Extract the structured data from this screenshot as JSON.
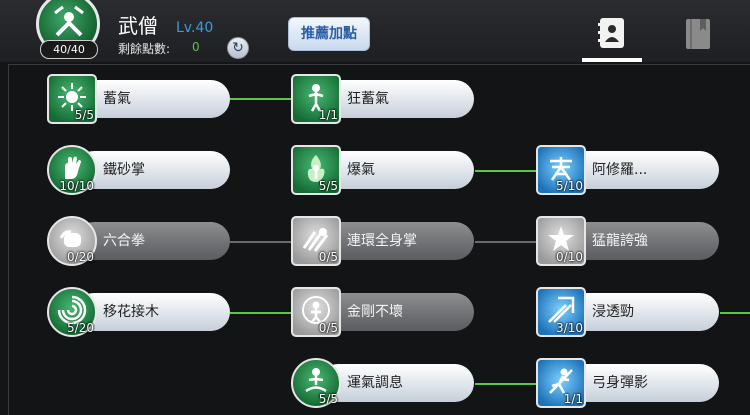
{
  "header": {
    "class_name": "武僧",
    "level": "Lv.40",
    "points_label": "剩餘點數:",
    "points_value": "0",
    "hp": "40/40",
    "recommend_label": "推薦加點",
    "refresh_icon": "refresh-icon",
    "tabs": [
      {
        "icon": "contact-book-icon",
        "active": true
      },
      {
        "icon": "bookmark-book-icon",
        "active": false
      }
    ]
  },
  "colors": {
    "connector_active": "#5bc64a",
    "connector_locked": "#6a6b6e",
    "level_blue": "#3d9ae0",
    "points_green": "#58c34a"
  },
  "skills": [
    {
      "name": "蓄氣",
      "level": "5/5",
      "shape": "square",
      "theme": "green",
      "locked": false,
      "icon": "sun-burst-icon"
    },
    {
      "name": "狂蓄氣",
      "level": "1/1",
      "shape": "square",
      "theme": "green",
      "locked": false,
      "icon": "power-up-figure-icon"
    },
    {
      "name": "鐵砂掌",
      "level": "10/10",
      "shape": "circle",
      "theme": "green",
      "locked": false,
      "icon": "palm-strike-icon"
    },
    {
      "name": "爆氣",
      "level": "5/5",
      "shape": "square",
      "theme": "green",
      "locked": false,
      "icon": "flame-figure-icon"
    },
    {
      "name": "阿修羅...",
      "level": "5/10",
      "shape": "square",
      "theme": "blue",
      "locked": false,
      "icon": "asura-glyph-icon"
    },
    {
      "name": "六合拳",
      "level": "0/20",
      "shape": "circle",
      "theme": "gray",
      "locked": true,
      "icon": "fist-icon"
    },
    {
      "name": "連環全身掌",
      "level": "0/5",
      "shape": "square",
      "theme": "gray",
      "locked": true,
      "icon": "combo-palm-icon"
    },
    {
      "name": "猛龍誇強",
      "level": "0/10",
      "shape": "square",
      "theme": "gray",
      "locked": true,
      "icon": "dragon-burst-icon"
    },
    {
      "name": "移花接木",
      "level": "5/20",
      "shape": "circle",
      "theme": "green",
      "locked": false,
      "icon": "swirl-icon"
    },
    {
      "name": "金剛不壞",
      "level": "0/5",
      "shape": "square",
      "theme": "gray",
      "locked": true,
      "icon": "aura-shield-icon"
    },
    {
      "name": "浸透勁",
      "level": "3/10",
      "shape": "square",
      "theme": "blue",
      "locked": false,
      "icon": "piercing-strike-icon"
    },
    {
      "name": "運氣調息",
      "level": "5/5",
      "shape": "circle",
      "theme": "green",
      "locked": false,
      "icon": "meditation-icon"
    },
    {
      "name": "弓身彈影",
      "level": "1/1",
      "shape": "square",
      "theme": "blue",
      "locked": false,
      "icon": "leap-figure-icon"
    }
  ]
}
